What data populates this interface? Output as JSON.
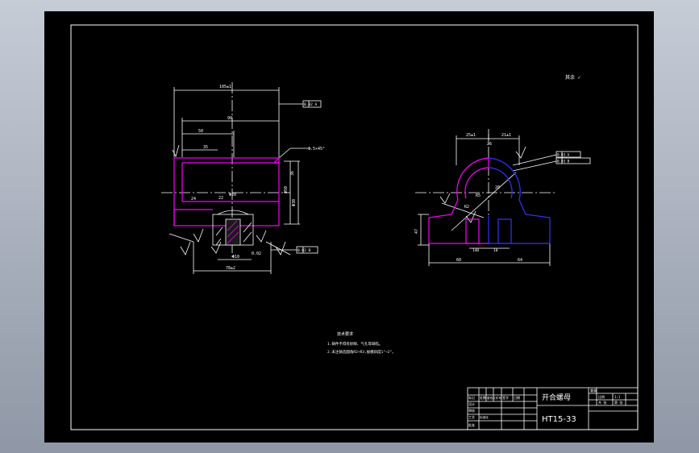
{
  "drawing": {
    "top_right_note": "其余 ✓",
    "left_view": {
      "dims": [
        "105±1",
        "90",
        "50",
        "35",
        "24",
        "22",
        "Φ20",
        "1.5×45°",
        "36",
        "Φ10",
        "Φ30",
        "Φ50",
        "78±2",
        "0.02"
      ],
      "callouts": [
        "0.02 A",
        "0.02 B"
      ]
    },
    "right_view": {
      "dims": [
        "25±1",
        "26",
        "21±1",
        "60",
        "64",
        "47",
        "R5",
        "R2",
        "140",
        "10",
        "20"
      ],
      "callouts": [
        "0.03 A",
        "0.03 B"
      ]
    },
    "notes": {
      "title": "技术要求",
      "lines": [
        "1.铸件不得有砂眼、气孔等缺陷。",
        "2.未注铸造圆角R2~R3,拔模斜度1°~2°。"
      ]
    },
    "title_block": {
      "part_name": "开合螺母",
      "material": "HT15-33",
      "label_a": "比例",
      "label_b": "1:1",
      "label_c": "共 张",
      "label_d": "第 张",
      "row_labels": [
        "标记",
        "处数",
        "更改文件号",
        "签字",
        "日期"
      ],
      "designer": "设计",
      "checker": "审核",
      "process": "工艺",
      "standard": "标准化",
      "approve": "批准",
      "weight": "重量"
    }
  },
  "colors": {
    "background": "#000000",
    "line": "#ffffff",
    "magenta": "#ff00ff",
    "blue": "#3333ff",
    "frame_outer": "#8f97a6"
  }
}
